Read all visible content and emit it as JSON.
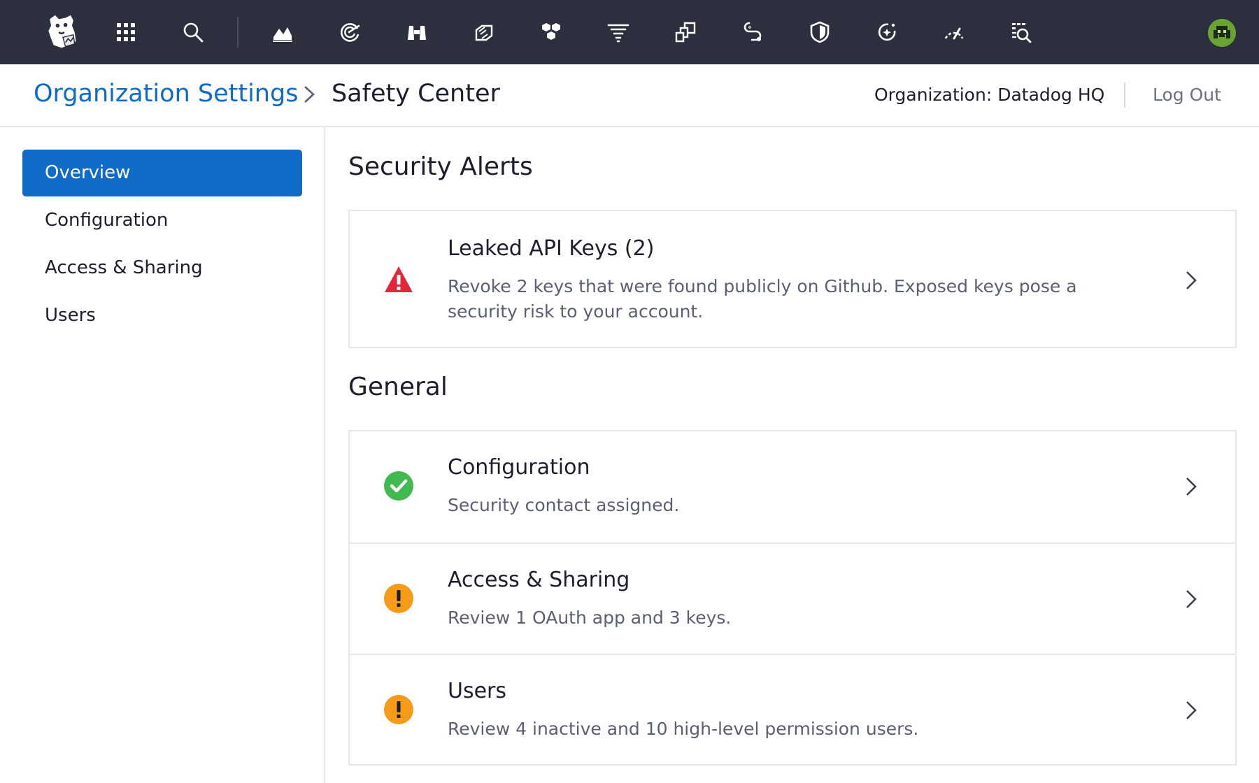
{
  "topbar": {
    "icons": [
      {
        "name": "datadog-logo-icon"
      },
      {
        "name": "apps-grid-icon"
      },
      {
        "name": "search-icon"
      },
      {
        "name": "dashboards-icon"
      },
      {
        "name": "monitors-icon"
      },
      {
        "name": "watchdog-binoculars-icon"
      },
      {
        "name": "integrations-icon"
      },
      {
        "name": "infrastructure-icon"
      },
      {
        "name": "logs-icon"
      },
      {
        "name": "apm-icon"
      },
      {
        "name": "synthetics-icon"
      },
      {
        "name": "security-shield-icon"
      },
      {
        "name": "rum-icon"
      },
      {
        "name": "performance-gauge-icon"
      },
      {
        "name": "ci-visibility-icon"
      }
    ],
    "avatar_color": "#6aa332"
  },
  "header": {
    "breadcrumb_parent": "Organization Settings",
    "breadcrumb_current": "Safety Center",
    "organization_label": "Organization: Datadog HQ",
    "logout_label": "Log Out"
  },
  "sidebar": {
    "items": [
      {
        "label": "Overview",
        "active": true
      },
      {
        "label": "Configuration",
        "active": false
      },
      {
        "label": "Access & Sharing",
        "active": false
      },
      {
        "label": "Users",
        "active": false
      }
    ]
  },
  "security_alerts": {
    "title": "Security Alerts",
    "items": [
      {
        "status": "critical",
        "title": "Leaked API Keys (2)",
        "description": "Revoke 2 keys that were found publicly on Github. Exposed keys pose a security risk to your account."
      }
    ]
  },
  "general": {
    "title": "General",
    "items": [
      {
        "status": "ok",
        "title": "Configuration",
        "description": "Security contact assigned."
      },
      {
        "status": "warning",
        "title": "Access & Sharing",
        "description": "Review 1 OAuth app and 3 keys."
      },
      {
        "status": "warning",
        "title": "Users",
        "description": "Review 4 inactive and 10 high-level permission users."
      }
    ]
  },
  "colors": {
    "topbar_bg": "#2b2f3e",
    "accent": "#0f6bc7",
    "critical": "#e3263a",
    "ok": "#3fb950",
    "warning": "#f59b17"
  }
}
